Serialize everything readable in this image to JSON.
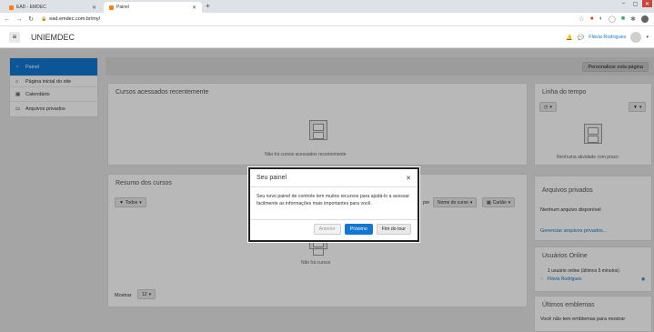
{
  "browser": {
    "tabs": [
      {
        "label": "EAD - EMDEC",
        "active": false
      },
      {
        "label": "Painel",
        "active": true
      }
    ],
    "url": "ead.emdec.com.br/my/"
  },
  "header": {
    "site_name": "UNIEMDEC",
    "user_name": "Flávia Rodrigues"
  },
  "nav": {
    "items": [
      {
        "label": "Painel",
        "icon": "dashboard-icon",
        "active": true
      },
      {
        "label": "Página inicial do site",
        "icon": "home-icon"
      },
      {
        "label": "Calendário",
        "icon": "calendar-icon"
      },
      {
        "label": "Arquivos privados",
        "icon": "file-icon"
      }
    ]
  },
  "toolbar": {
    "customize_label": "Personalizar esta página"
  },
  "recent": {
    "title": "Cursos acessados recentemente",
    "empty": "Não há cursos acessados recentemente"
  },
  "overview": {
    "title": "Resumo dos cursos",
    "filter_label": "Todos",
    "sort_prefix": "por",
    "sort_label": "Nome do curso",
    "view_label": "Cartão",
    "empty": "Não há cursos",
    "show_label": "Mostrar",
    "show_value": "12"
  },
  "timeline": {
    "title": "Linha do tempo",
    "empty": "Nenhuma atividade com prazo"
  },
  "private_files": {
    "title": "Arquivos privados",
    "empty": "Nenhum arquivo disponível",
    "manage_link": "Gerenciar arquivos privados..."
  },
  "online_users": {
    "title": "Usuários Online",
    "summary": "1 usuário online (últimos 5 minutos)",
    "user": "Flávia Rodrigues"
  },
  "badges": {
    "title": "Últimos emblemas",
    "empty": "Você não tem emblemas para mostrar"
  },
  "modal": {
    "title": "Seu painel",
    "body": "Seu novo painel de controle tem muitos recursos para ajudá-lo a acessar facilmente as informações mais importantes para você.",
    "prev_label": "Anterior",
    "next_label": "Próximo",
    "end_label": "Fim do tour"
  },
  "colors": {
    "accent": "#1177d1",
    "window_close": "#c9463d"
  }
}
